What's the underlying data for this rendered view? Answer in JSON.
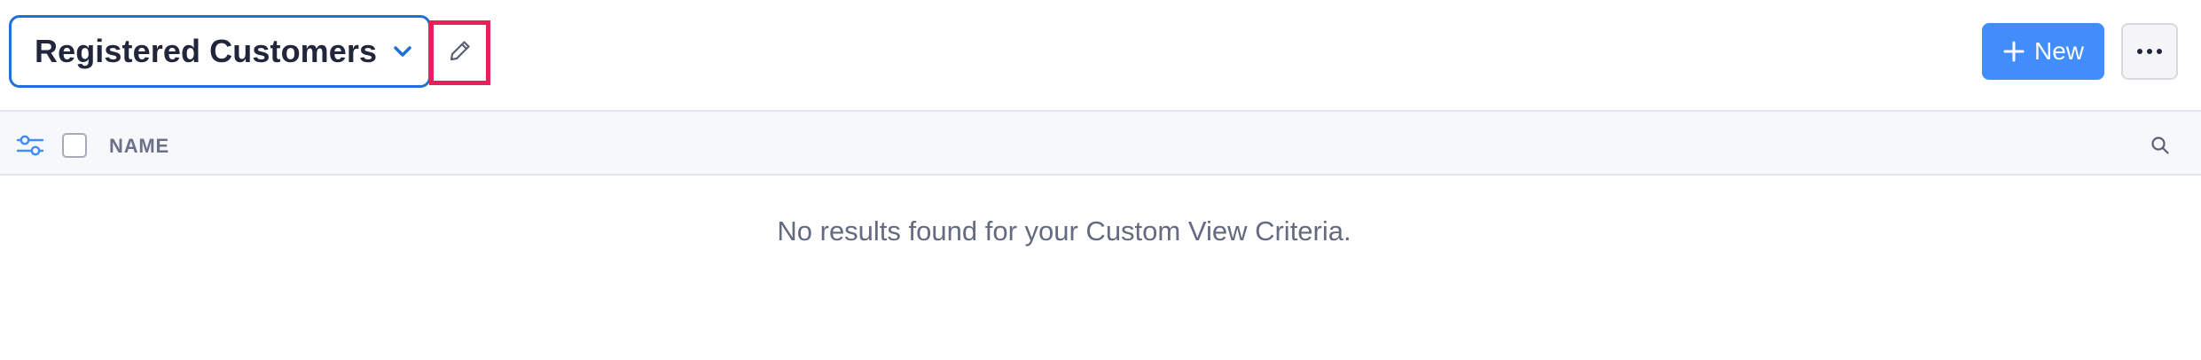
{
  "header": {
    "view_title": "Registered Customers",
    "new_label": "New",
    "accent_color": "#408dfb",
    "highlight_color": "#e8205a"
  },
  "table": {
    "columns": [
      "NAME"
    ]
  },
  "empty_state": {
    "message": "No results found for your Custom View Criteria."
  },
  "icons": {
    "view_dropdown": "chevron-down-icon",
    "edit_view": "pencil-icon",
    "new": "plus-icon",
    "more": "ellipsis-icon",
    "filter": "sliders-icon",
    "search": "search-icon"
  }
}
